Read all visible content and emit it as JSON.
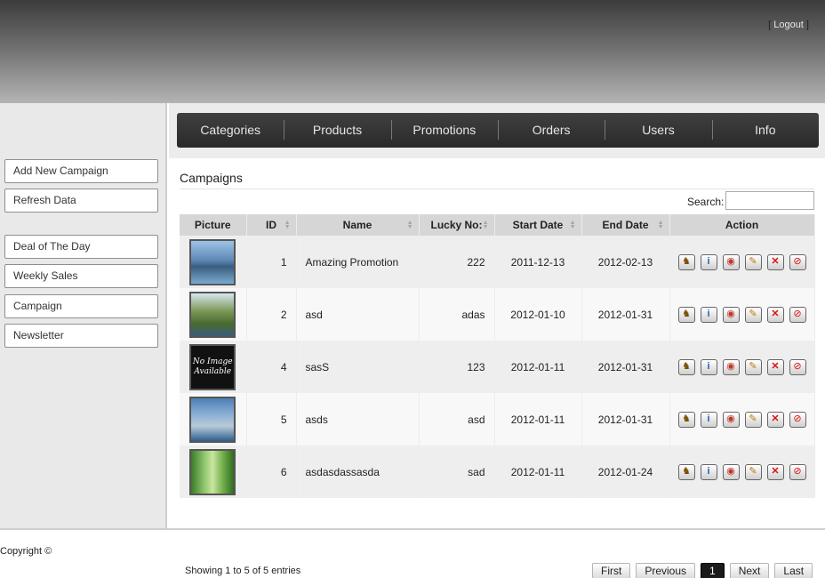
{
  "header": {
    "logout_label": "Logout"
  },
  "sidebar": {
    "items": [
      {
        "label": "Add New Campaign"
      },
      {
        "label": "Refresh Data"
      },
      {
        "label": "Deal of The Day"
      },
      {
        "label": "Weekly Sales"
      },
      {
        "label": "Campaign"
      },
      {
        "label": "Newsletter"
      }
    ]
  },
  "nav": {
    "items": [
      {
        "label": "Categories"
      },
      {
        "label": "Products"
      },
      {
        "label": "Promotions"
      },
      {
        "label": "Orders"
      },
      {
        "label": "Users"
      },
      {
        "label": "Info"
      }
    ]
  },
  "panel": {
    "title": "Campaigns",
    "search_label": "Search:",
    "search_value": "",
    "columns": [
      "Picture",
      "ID",
      "Name",
      "Lucky No:",
      "Start Date",
      "End Date",
      "Action"
    ],
    "rows": [
      {
        "id": "1",
        "name": "Amazing Promotion",
        "lucky": "222",
        "start": "2011-12-13",
        "end": "2012-02-13"
      },
      {
        "id": "2",
        "name": "asd",
        "lucky": "adas",
        "start": "2012-01-10",
        "end": "2012-01-31"
      },
      {
        "id": "4",
        "name": "sasS",
        "lucky": "123",
        "start": "2012-01-11",
        "end": "2012-01-31",
        "picture_text": "No Image Available"
      },
      {
        "id": "5",
        "name": "asds",
        "lucky": "asd",
        "start": "2012-01-11",
        "end": "2012-01-31"
      },
      {
        "id": "6",
        "name": "asdasdassasda",
        "lucky": "sad",
        "start": "2012-01-11",
        "end": "2012-01-24"
      }
    ],
    "info": "Showing 1 to 5 of 5 entries",
    "pager": {
      "first": "First",
      "previous": "Previous",
      "current": "1",
      "next": "Next",
      "last": "Last"
    }
  },
  "footer": {
    "copyright": "Copyright ©"
  }
}
